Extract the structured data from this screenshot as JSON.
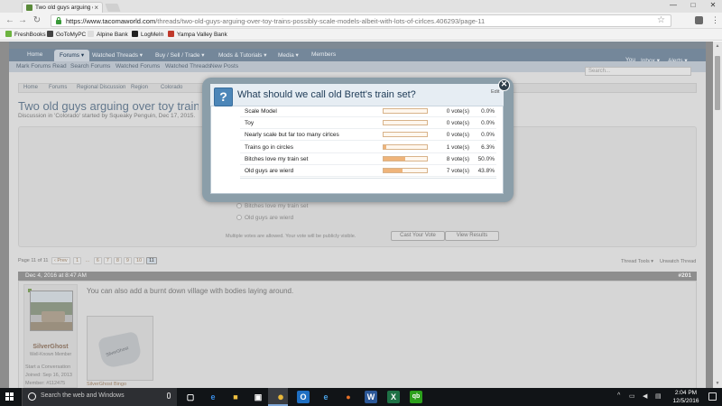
{
  "browser": {
    "tab_title": "Two old guys arguing ov...",
    "url_domain": "https://www.tacomaworld.com",
    "url_path": "/threads/two-old-guys-arguing-over-toy-trains-possibly-scale-models-albeit-with-lots-of-cirlces.406293/page-11",
    "window_controls": [
      "—",
      "□",
      "✕"
    ],
    "bookmarks": [
      {
        "label": "FreshBooks",
        "icon": "freshbooks-icon",
        "color": "#6cb33f"
      },
      {
        "label": "GoToMyPC",
        "icon": "gotomypc-icon",
        "color": "#444444"
      },
      {
        "label": "Alpine Bank",
        "icon": "page-icon",
        "color": "#dddddd"
      },
      {
        "label": "LogMeIn",
        "icon": "logmein-icon",
        "color": "#222222"
      },
      {
        "label": "Yampa Valley Bank",
        "icon": "yvb-icon",
        "color": "#c0392b"
      }
    ]
  },
  "site": {
    "nav_tabs": [
      "Home",
      "Forums",
      "Watched Threads",
      "Buy / Sell / Trade",
      "Mods & Tutorials",
      "Media",
      "Members"
    ],
    "user_nav": [
      "You",
      "Inbox",
      "Alerts"
    ],
    "subnav": [
      "Mark Forums Read",
      "Search Forums",
      "Watched Forums",
      "Watched Threads",
      "New Posts"
    ],
    "search_placeholder": "Search...",
    "breadcrumbs": [
      "Home",
      "Forums",
      "Regional Discussion",
      "Region",
      "Colorado"
    ],
    "thread_title": "Two old guys arguing over toy trains/possibly",
    "thread_meta": "Discussion in 'Colorado' started by Squeaky Penguin, Dec 17, 2015."
  },
  "poll_background": {
    "options": [
      "Bitches love my train set",
      "Old guys are wierd"
    ],
    "note": "Multiple votes are allowed. Your vote will be publicly visible.",
    "cast_vote": "Cast Your Vote",
    "view_results": "View Results"
  },
  "page_nav": {
    "label": "Page 11 of 11",
    "prev": "‹ Prev",
    "pages": [
      "1",
      "…",
      "6",
      "7",
      "8",
      "9",
      "10",
      "11"
    ],
    "thread_tools": "Thread Tools",
    "unwatch": "Unwatch Thread"
  },
  "post": {
    "date": "Dec 4, 2016 at 8:47 AM",
    "number": "#201",
    "text": "You can also add a burnt down village with bodies laying around.",
    "username": "SilverGhost",
    "user_title": "Well-Known Member",
    "info": [
      "Start a Conversation",
      "Joined: Sep 16, 2013",
      "Member: #112475"
    ],
    "image_caption": "SilverGhost Bingo",
    "image_text": "SilverGhost"
  },
  "modal": {
    "title": "What should we call old Brett's train set?",
    "edit_label": "Edit",
    "close_glyph": "✕",
    "icon_glyph": "?",
    "results": [
      {
        "label": "Scale Model",
        "votes": "0 vote(s)",
        "percent": "0.0%",
        "fraction": 0.0
      },
      {
        "label": "Toy",
        "votes": "0 vote(s)",
        "percent": "0.0%",
        "fraction": 0.0
      },
      {
        "label": "Nearly scale but far too many cirlces",
        "votes": "0 vote(s)",
        "percent": "0.0%",
        "fraction": 0.0
      },
      {
        "label": "Trains go in circles",
        "votes": "1 vote(s)",
        "percent": "6.3%",
        "fraction": 0.063
      },
      {
        "label": "Bitches love my train set",
        "votes": "8 vote(s)",
        "percent": "50.0%",
        "fraction": 0.5
      },
      {
        "label": "Old guys are wierd",
        "votes": "7 vote(s)",
        "percent": "43.8%",
        "fraction": 0.438
      }
    ]
  },
  "taskbar": {
    "search_placeholder": "Search the web and Windows",
    "time": "2:04 PM",
    "date": "12/5/2016",
    "apps": [
      {
        "icon": "task-view-icon",
        "glyph": "▢",
        "color": "#ffffff",
        "bg": "transparent"
      },
      {
        "icon": "edge-icon",
        "glyph": "e",
        "color": "#3a8ee6",
        "bg": "transparent"
      },
      {
        "icon": "file-explorer-icon",
        "glyph": "■",
        "color": "#f0c040",
        "bg": "transparent"
      },
      {
        "icon": "store-icon",
        "glyph": "▣",
        "color": "#ffffff",
        "bg": "transparent"
      },
      {
        "icon": "chrome-icon",
        "glyph": "●",
        "color": "#e8b83a",
        "bg": "transparent"
      },
      {
        "icon": "outlook-icon",
        "glyph": "O",
        "color": "#ffffff",
        "bg": "#1f6fc2"
      },
      {
        "icon": "internet-explorer-icon",
        "glyph": "e",
        "color": "#4aa3e8",
        "bg": "transparent"
      },
      {
        "icon": "firefox-icon",
        "glyph": "●",
        "color": "#e76f26",
        "bg": "transparent"
      },
      {
        "icon": "word-icon",
        "glyph": "W",
        "color": "#ffffff",
        "bg": "#2b5797"
      },
      {
        "icon": "excel-icon",
        "glyph": "X",
        "color": "#ffffff",
        "bg": "#1e7145"
      },
      {
        "icon": "quickbooks-icon",
        "glyph": "qb",
        "color": "#ffffff",
        "bg": "#2ca01c"
      }
    ]
  }
}
